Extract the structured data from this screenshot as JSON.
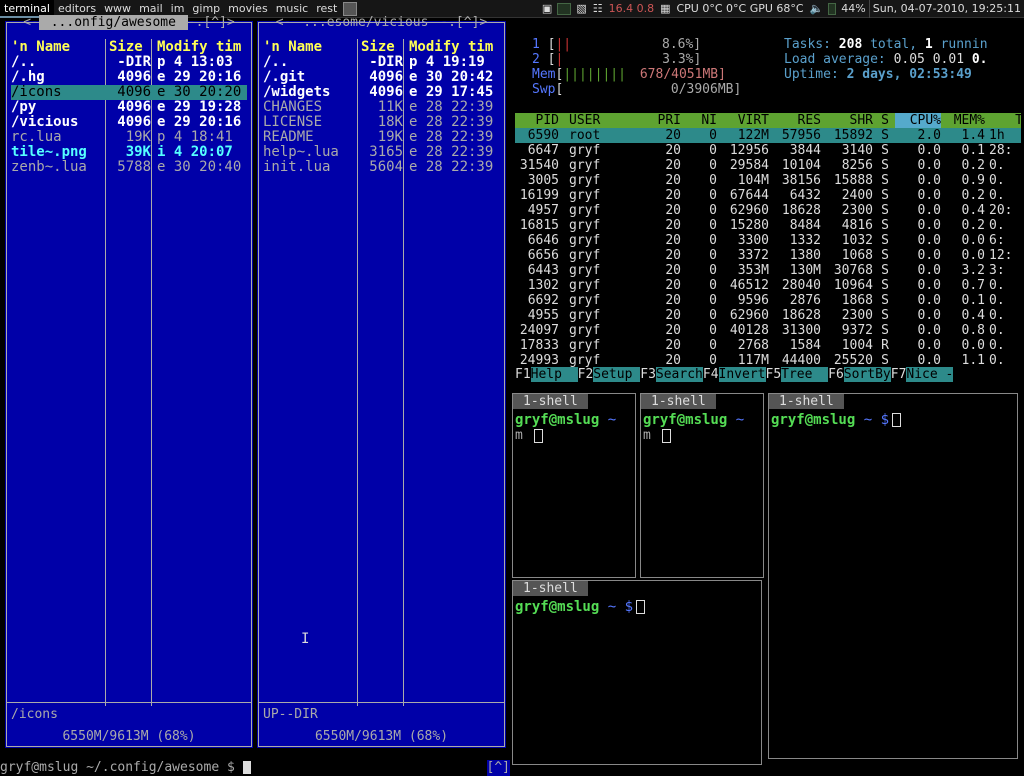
{
  "wibox": {
    "tags": [
      "terminal",
      "editors",
      "www",
      "mail",
      "im",
      "gimp",
      "movies",
      "music",
      "rest"
    ],
    "load": "16.4 0.8",
    "cpu": "CPU 0°C 0°C GPU 68°C",
    "volume": "44%",
    "clock": "Sun, 04-07-2010, 19:25:11",
    "icons": [
      "layout-icon",
      "terminal-icon",
      "memory-icon",
      "network-icon",
      "cpu-icon",
      "volume-icon",
      "battery-graph"
    ]
  },
  "mc": {
    "left": {
      "title": " ...onfig/awesome ",
      "title_prefix": "<-",
      "title_suffix": "-.[^]>",
      "headers": {
        "name": "'n Name",
        "size": "Size",
        "date": "Modify tim"
      },
      "files": [
        {
          "name": "/..",
          "size": "-DIR",
          "date": "p  4 13:03",
          "kind": "dir"
        },
        {
          "name": "/.hg",
          "size": "4096",
          "date": "e 29 20:16",
          "kind": "dir"
        },
        {
          "name": "/icons",
          "size": "4096",
          "date": "e 30 20:20",
          "kind": "sel"
        },
        {
          "name": "/py",
          "size": "4096",
          "date": "e 29 19:28",
          "kind": "dir"
        },
        {
          "name": "/vicious",
          "size": "4096",
          "date": "e 29 20:16",
          "kind": "dir"
        },
        {
          "name": " rc.lua",
          "size": "19K",
          "date": "p  4 18:41",
          "kind": "fil"
        },
        {
          "name": " tile~.png",
          "size": "39K",
          "date": "i  4 20:07",
          "kind": "img"
        },
        {
          "name": " zenb~.lua",
          "size": "5788",
          "date": "e 30 20:40",
          "kind": "fil"
        }
      ],
      "status": "/icons",
      "free": "6550M/9613M (68%)"
    },
    "right": {
      "title": " ...esome/vicious ",
      "title_prefix": "<-",
      "title_suffix": "-.[^]>",
      "headers": {
        "name": "'n Name",
        "size": "Size",
        "date": "Modify tim"
      },
      "files": [
        {
          "name": "/..",
          "size": "-DIR",
          "date": "p  4 19:19",
          "kind": "dir"
        },
        {
          "name": "/.git",
          "size": "4096",
          "date": "e 30 20:42",
          "kind": "dir"
        },
        {
          "name": "/widgets",
          "size": "4096",
          "date": "e 29 17:45",
          "kind": "dir"
        },
        {
          "name": " CHANGES",
          "size": "11K",
          "date": "e 28 22:39",
          "kind": "fil"
        },
        {
          "name": " LICENSE",
          "size": "18K",
          "date": "e 28 22:39",
          "kind": "fil"
        },
        {
          "name": " README",
          "size": "19K",
          "date": "e 28 22:39",
          "kind": "fil"
        },
        {
          "name": " help~.lua",
          "size": "3165",
          "date": "e 28 22:39",
          "kind": "fil"
        },
        {
          "name": " init.lua",
          "size": "5604",
          "date": "e 28 22:39",
          "kind": "fil"
        }
      ],
      "status": "UP--DIR",
      "free": "6550M/9613M (68%)"
    },
    "cmdline": "gryf@mslug ~/.config/awesome $ ",
    "cmd_button": "[^]"
  },
  "htop": {
    "cpu1": {
      "label": "1",
      "bars": "||",
      "pct": "8.6%]"
    },
    "cpu2": {
      "label": "2",
      "bars": "|",
      "pct": "3.3%]"
    },
    "mem": {
      "label": "Mem",
      "bars": "||||||||",
      "val": "678/4051MB]"
    },
    "swp": {
      "label": "Swp",
      "bars": "",
      "val": "0/3906MB]"
    },
    "tasks": {
      "label": "Tasks:",
      "total": "208",
      "total_label": "total,",
      "running": "1",
      "running_label": "runnin"
    },
    "load": {
      "label": "Load average:",
      "v1": "0.05",
      "v2": "0.01",
      "v3": "0."
    },
    "uptime": {
      "label": "Uptime:",
      "value": "2 days, 02:53:49"
    },
    "header": {
      "pid": "PID",
      "user": "USER",
      "pri": "PRI",
      "ni": "NI",
      "virt": "VIRT",
      "res": "RES",
      "shr": "SHR",
      "s": "S",
      "cpu": "CPU%",
      "mem": "MEM%",
      "time": "T"
    },
    "rows": [
      {
        "pid": "6590",
        "user": "root",
        "pri": "20",
        "ni": "0",
        "virt": "122M",
        "res": "57956",
        "shr": "15892",
        "s": "S",
        "cpu": "2.0",
        "mem": "1.4",
        "time": "1h"
      },
      {
        "pid": "6647",
        "user": "gryf",
        "pri": "20",
        "ni": "0",
        "virt": "12956",
        "res": "3844",
        "shr": "3140",
        "s": "S",
        "cpu": "0.0",
        "mem": "0.1",
        "time": "28:"
      },
      {
        "pid": "31540",
        "user": "gryf",
        "pri": "20",
        "ni": "0",
        "virt": "29584",
        "res": "10104",
        "shr": "8256",
        "s": "S",
        "cpu": "0.0",
        "mem": "0.2",
        "time": "0."
      },
      {
        "pid": "3005",
        "user": "gryf",
        "pri": "20",
        "ni": "0",
        "virt": "104M",
        "res": "38156",
        "shr": "15888",
        "s": "S",
        "cpu": "0.0",
        "mem": "0.9",
        "time": "0."
      },
      {
        "pid": "16199",
        "user": "gryf",
        "pri": "20",
        "ni": "0",
        "virt": "67644",
        "res": "6432",
        "shr": "2400",
        "s": "S",
        "cpu": "0.0",
        "mem": "0.2",
        "time": "0."
      },
      {
        "pid": "4957",
        "user": "gryf",
        "pri": "20",
        "ni": "0",
        "virt": "62960",
        "res": "18628",
        "shr": "2300",
        "s": "S",
        "cpu": "0.0",
        "mem": "0.4",
        "time": "20:"
      },
      {
        "pid": "16815",
        "user": "gryf",
        "pri": "20",
        "ni": "0",
        "virt": "15280",
        "res": "8484",
        "shr": "4816",
        "s": "S",
        "cpu": "0.0",
        "mem": "0.2",
        "time": "0."
      },
      {
        "pid": "6646",
        "user": "gryf",
        "pri": "20",
        "ni": "0",
        "virt": "3300",
        "res": "1332",
        "shr": "1032",
        "s": "S",
        "cpu": "0.0",
        "mem": "0.0",
        "time": "6:"
      },
      {
        "pid": "6656",
        "user": "gryf",
        "pri": "20",
        "ni": "0",
        "virt": "3372",
        "res": "1380",
        "shr": "1068",
        "s": "S",
        "cpu": "0.0",
        "mem": "0.0",
        "time": "12:"
      },
      {
        "pid": "6443",
        "user": "gryf",
        "pri": "20",
        "ni": "0",
        "virt": "353M",
        "res": "130M",
        "shr": "30768",
        "s": "S",
        "cpu": "0.0",
        "mem": "3.2",
        "time": "3:"
      },
      {
        "pid": "1302",
        "user": "gryf",
        "pri": "20",
        "ni": "0",
        "virt": "46512",
        "res": "28040",
        "shr": "10964",
        "s": "S",
        "cpu": "0.0",
        "mem": "0.7",
        "time": "0."
      },
      {
        "pid": "6692",
        "user": "gryf",
        "pri": "20",
        "ni": "0",
        "virt": "9596",
        "res": "2876",
        "shr": "1868",
        "s": "S",
        "cpu": "0.0",
        "mem": "0.1",
        "time": "0."
      },
      {
        "pid": "4955",
        "user": "gryf",
        "pri": "20",
        "ni": "0",
        "virt": "62960",
        "res": "18628",
        "shr": "2300",
        "s": "S",
        "cpu": "0.0",
        "mem": "0.4",
        "time": "0."
      },
      {
        "pid": "24097",
        "user": "gryf",
        "pri": "20",
        "ni": "0",
        "virt": "40128",
        "res": "31300",
        "shr": "9372",
        "s": "S",
        "cpu": "0.0",
        "mem": "0.8",
        "time": "0."
      },
      {
        "pid": "17833",
        "user": "gryf",
        "pri": "20",
        "ni": "0",
        "virt": "2768",
        "res": "1584",
        "shr": "1004",
        "s": "R",
        "cpu": "0.0",
        "mem": "0.0",
        "time": "0."
      },
      {
        "pid": "24993",
        "user": "gryf",
        "pri": "20",
        "ni": "0",
        "virt": "117M",
        "res": "44400",
        "shr": "25520",
        "s": "S",
        "cpu": "0.0",
        "mem": "1.1",
        "time": "0."
      }
    ],
    "fkeys": [
      {
        "key": "F1",
        "label": "Help  "
      },
      {
        "key": "F2",
        "label": "Setup "
      },
      {
        "key": "F3",
        "label": "Search"
      },
      {
        "key": "F4",
        "label": "Invert"
      },
      {
        "key": "F5",
        "label": "Tree  "
      },
      {
        "key": "F6",
        "label": "SortBy"
      },
      {
        "key": "F7",
        "label": "Nice -"
      }
    ]
  },
  "shells": {
    "tab_label": "1-shell",
    "user_host": "gryf@mslug",
    "dir": "~",
    "prompt": "$",
    "partial": "m"
  }
}
